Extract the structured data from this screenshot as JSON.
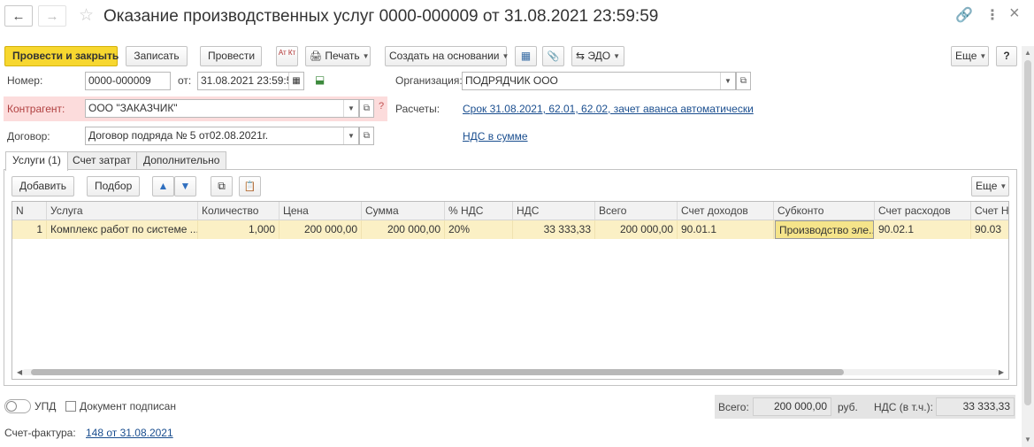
{
  "window": {
    "title": "Оказание производственных услуг 0000-000009 от 31.08.2021 23:59:59"
  },
  "icons": {
    "back": "←",
    "forward": "→",
    "star": "☆",
    "link": "🔗",
    "menu": "⋮",
    "close": "×",
    "dt_kt": "Ат Кт",
    "print": "🖨",
    "structure": "▦",
    "attach": "📎",
    "edo": "⇆",
    "up": "▲",
    "down": "▼",
    "copy": "⧉",
    "paste": "📋",
    "calendar": "▦",
    "selection": "⬓"
  },
  "toolbar": {
    "post_close": "Провести и закрыть",
    "save": "Записать",
    "post": "Провести",
    "print": "Печать",
    "create_based": "Создать на основании",
    "edo": "ЭДО",
    "more": "Еще",
    "help": "?"
  },
  "form": {
    "number_label": "Номер:",
    "number_value": "0000-000009",
    "date_label": "от:",
    "date_value": "31.08.2021 23:59:59",
    "org_label": "Организация:",
    "org_value": "ПОДРЯДЧИК ООО",
    "counterparty_label": "Контрагент:",
    "counterparty_value": "ООО \"ЗАКАЗЧИК\"",
    "counterparty_hint": "?",
    "settlements_label": "Расчеты:",
    "settlements_link": "Срок 31.08.2021, 62.01, 62.02, зачет аванса автоматически",
    "contract_label": "Договор:",
    "contract_value": "Договор подряда № 5 от02.08.2021г.",
    "vat_link": "НДС в сумме"
  },
  "tabs": [
    {
      "label": "Услуги (1)",
      "active": true
    },
    {
      "label": "Счет затрат",
      "active": false
    },
    {
      "label": "Дополнительно",
      "active": false
    }
  ],
  "table_toolbar": {
    "add": "Добавить",
    "pick": "Подбор",
    "more": "Еще"
  },
  "table": {
    "columns": [
      "N",
      "Услуга",
      "Количество",
      "Цена",
      "Сумма",
      "% НДС",
      "НДС",
      "Всего",
      "Счет доходов",
      "Субконто",
      "Счет расходов",
      "Счет НДС"
    ],
    "rows": [
      [
        "1",
        "Комплекс работ по системе ...",
        "1,000",
        "200 000,00",
        "200 000,00",
        "20%",
        "33 333,33",
        "200 000,00",
        "90.01.1",
        "Производство эле...",
        "90.02.1",
        "90.03"
      ]
    ]
  },
  "footer": {
    "upd_label": "УПД",
    "signed_label": "Документ подписан",
    "invoice_label": "Счет-фактура:",
    "invoice_link": "148 от 31.08.2021",
    "total_label": "Всего:",
    "total_value": "200 000,00",
    "currency": "руб.",
    "vat_label": "НДС (в т.ч.):",
    "vat_value": "33 333,33"
  },
  "colors": {
    "primary_button": "#f7d72f",
    "selected_row": "#fbf0c5",
    "required_field_bg": "#fcdcdc",
    "link": "#1a4e8f"
  }
}
